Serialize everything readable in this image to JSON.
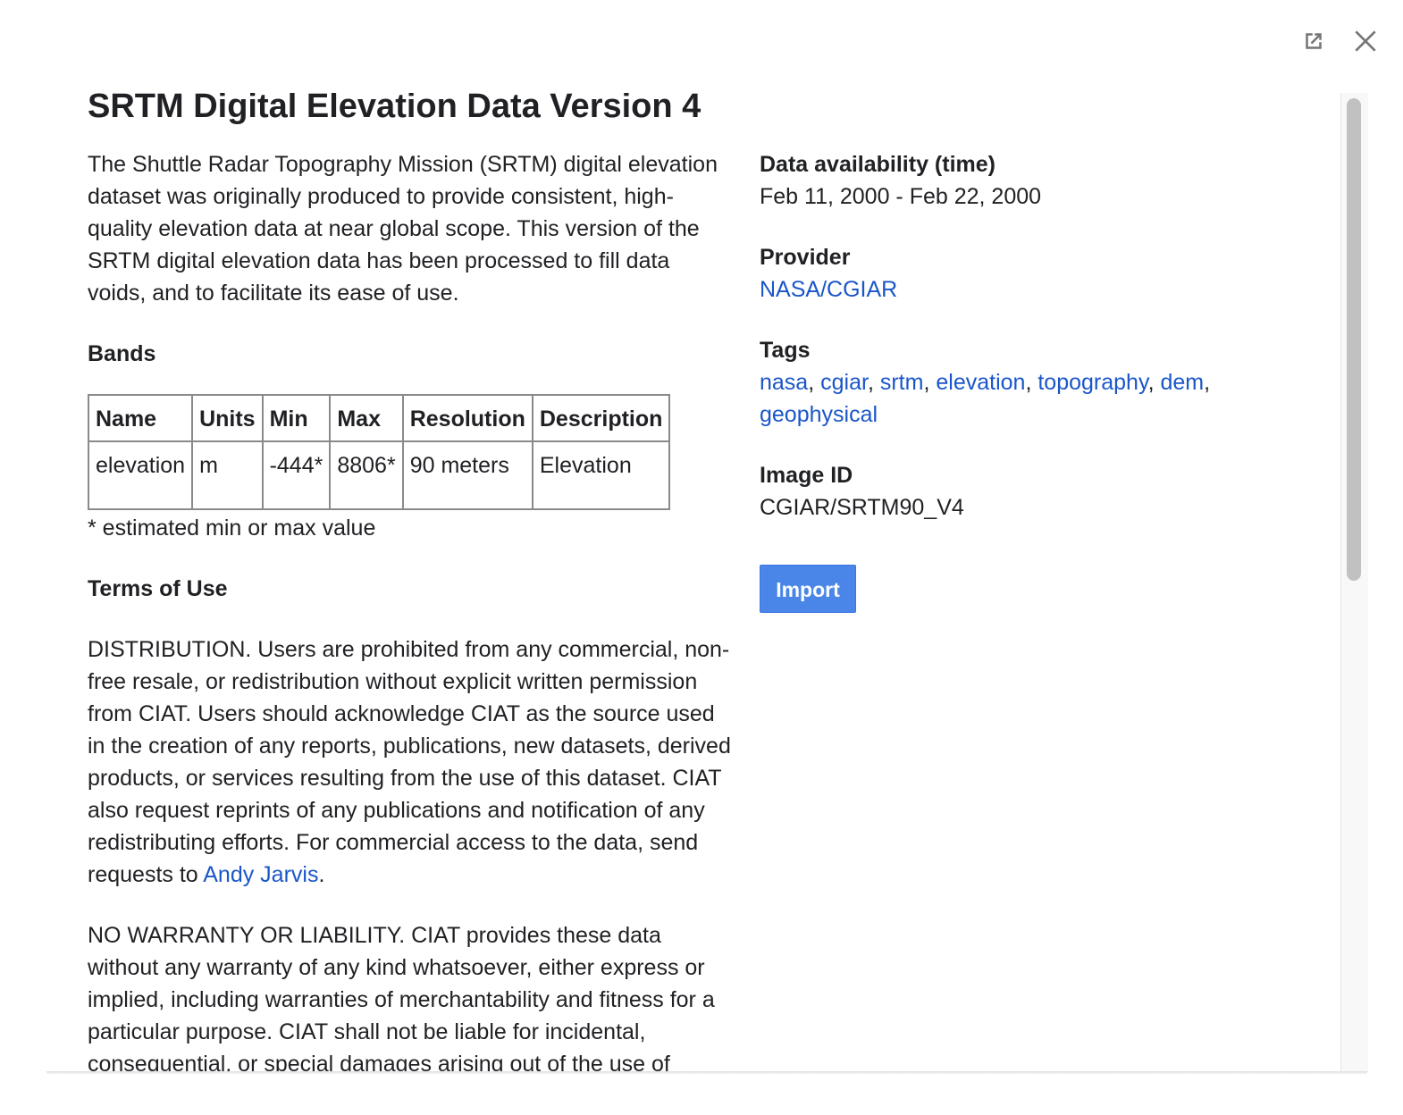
{
  "dialog": {
    "title": "SRTM Digital Elevation Data Version 4",
    "description": "The Shuttle Radar Topography Mission (SRTM) digital elevation dataset was originally produced to provide consistent, high-quality elevation data at near global scope. This version of the SRTM digital elevation data has been processed to fill data voids, and to facilitate its ease of use.",
    "icons": {
      "open": "open-in-new-icon",
      "close": "close-icon"
    }
  },
  "bands": {
    "title": "Bands",
    "headers": [
      "Name",
      "Units",
      "Min",
      "Max",
      "Resolution",
      "Description"
    ],
    "rows": [
      [
        "elevation",
        "m",
        "-444*",
        "8806*",
        "90 meters",
        "Elevation"
      ]
    ],
    "footnote": "* estimated min or max value"
  },
  "terms": {
    "title": "Terms of Use",
    "distribution_text": "DISTRIBUTION. Users are prohibited from any commercial, non-free resale, or redistribution without explicit written permission from CIAT. Users should acknowledge CIAT as the source used in the creation of any reports, publications, new datasets, derived products, or services resulting from the use of this dataset. CIAT also request reprints of any publications and notification of any redistributing efforts. For commercial access to the data, send requests to ",
    "contact_link": "Andy Jarvis",
    "distribution_end": ".",
    "warranty_text": "NO WARRANTY OR LIABILITY. CIAT provides these data without any warranty of any kind whatsoever, either express or implied, including warranties of merchantability and fitness for a particular purpose. CIAT shall not be liable for incidental, consequential, or special damages arising out of the use of"
  },
  "metadata": {
    "availability_label": "Data availability (time)",
    "availability_value": "Feb 11, 2000 - Feb 22, 2000",
    "provider_label": "Provider",
    "provider_value": "NASA/CGIAR",
    "tags_label": "Tags",
    "tags": [
      "nasa",
      "cgiar",
      "srtm",
      "elevation",
      "topography",
      "dem",
      "geophysical"
    ],
    "image_id_label": "Image ID",
    "image_id_value": "CGIAR/SRTM90_V4",
    "import_label": "Import"
  },
  "colors": {
    "link": "#1a56c9",
    "button": "#4a86e8",
    "text": "#202124"
  }
}
